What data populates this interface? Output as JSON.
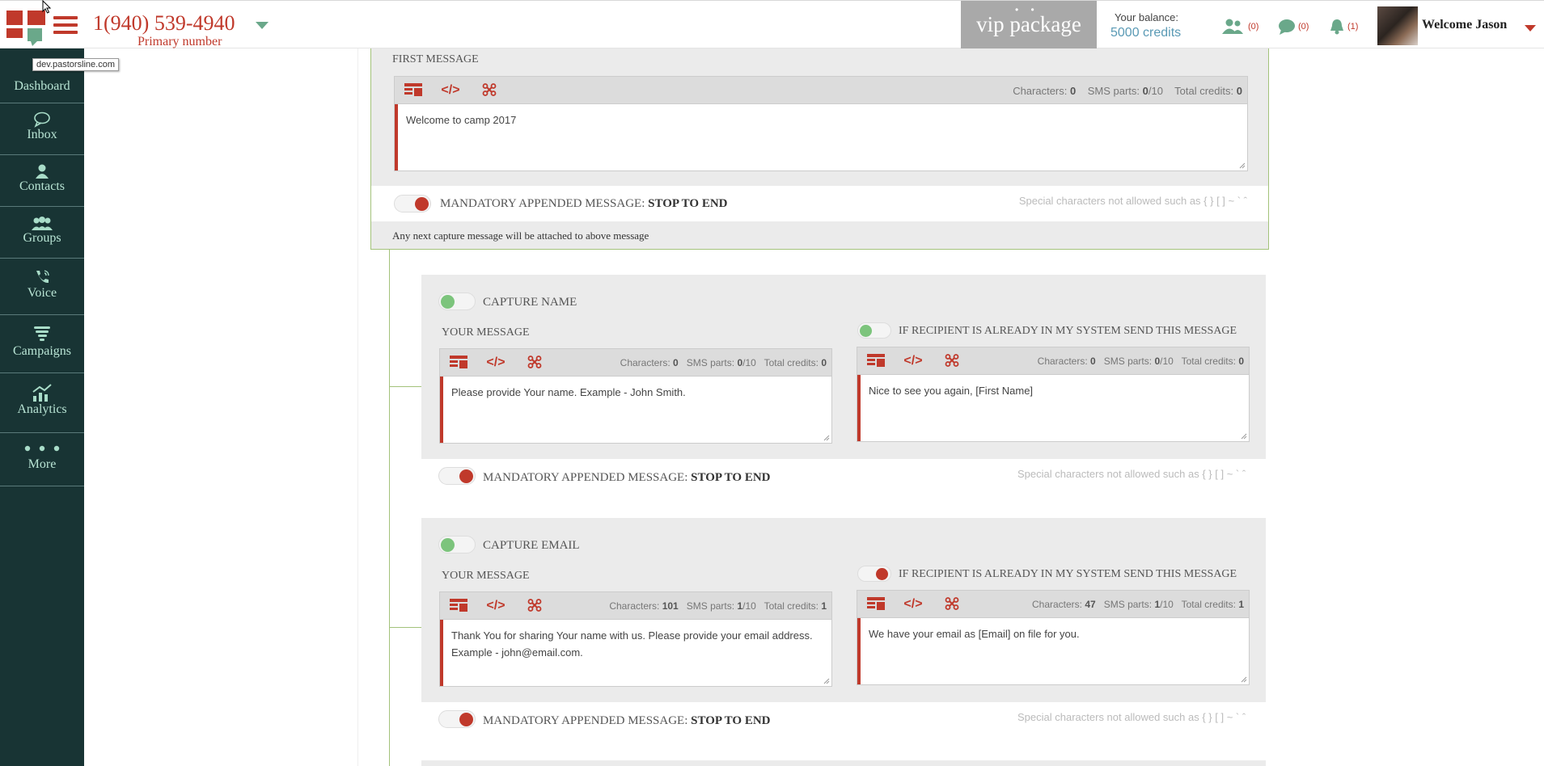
{
  "header": {
    "phone": "1(940) 539-4940",
    "phone_sub": "Primary number",
    "vip": "vip package",
    "vip_dots": "• •",
    "balance_label": "Your balance:",
    "balance_value": "5000 credits",
    "contacts_count": "(0)",
    "messages_count": "(0)",
    "notifications_count": "(1)",
    "welcome": "Welcome Jason"
  },
  "tooltip": "dev.pastorsline.com",
  "sidebar": {
    "items": [
      {
        "label": "Dashboard",
        "icon": "dashboard-icon"
      },
      {
        "label": "Inbox",
        "icon": "chat-icon"
      },
      {
        "label": "Contacts",
        "icon": "user-icon"
      },
      {
        "label": "Groups",
        "icon": "group-icon"
      },
      {
        "label": "Voice",
        "icon": "phone-icon"
      },
      {
        "label": "Campaigns",
        "icon": "tornado-icon"
      },
      {
        "label": "Analytics",
        "icon": "chart-icon"
      },
      {
        "label": "More",
        "icon": "dots-icon"
      }
    ]
  },
  "colors": {
    "brand_red": "#c0392b",
    "sidebar_bg": "#183434",
    "accent_green": "#a3c27a"
  },
  "first_message": {
    "label": "FIRST MESSAGE",
    "stats": {
      "characters": "0",
      "sms_parts": "0",
      "sms_total": "/10",
      "total_credits": "0"
    },
    "text": "Welcome to camp 2017",
    "mandatory": "MANDATORY APPENDED MESSAGE:",
    "mandatory_bold": "STOP TO END",
    "special": "Special characters not allowed such as { } [ ] ~ ` ˆ",
    "note": "Any next capture message will be attached to above message"
  },
  "labels": {
    "characters": "Characters:",
    "sms_parts": "SMS parts:",
    "total_credits": "Total credits:",
    "your_message": "YOUR MESSAGE",
    "if_recipient": "IF RECIPIENT IS ALREADY IN MY SYSTEM SEND THIS MESSAGE"
  },
  "capture_name": {
    "title": "CAPTURE NAME",
    "left": {
      "stats": {
        "characters": "0",
        "sms_parts": "0",
        "sms_total": "/10",
        "total_credits": "0"
      },
      "text": "Please provide Your name. Example - John Smith."
    },
    "right": {
      "stats": {
        "characters": "0",
        "sms_parts": "0",
        "sms_total": "/10",
        "total_credits": "0"
      },
      "text": "Nice to see you again, [First Name]"
    },
    "mandatory": "MANDATORY APPENDED MESSAGE:",
    "mandatory_bold": "STOP TO END",
    "special": "Special characters not allowed such as { } [ ] ~ ` ˆ"
  },
  "capture_email": {
    "title": "CAPTURE EMAIL",
    "left": {
      "stats": {
        "characters": "101",
        "sms_parts": "1",
        "sms_total": "/10",
        "total_credits": "1"
      },
      "text": "Thank You for sharing Your name with us. Please provide your email address. Example - john@email.com."
    },
    "right": {
      "stats": {
        "characters": "47",
        "sms_parts": "1",
        "sms_total": "/10",
        "total_credits": "1"
      },
      "text": "We have your email as [Email] on file for you."
    },
    "mandatory": "MANDATORY APPENDED MESSAGE:",
    "mandatory_bold": "STOP TO END",
    "special": "Special characters not allowed such as { } [ ] ~ ` ˆ"
  }
}
